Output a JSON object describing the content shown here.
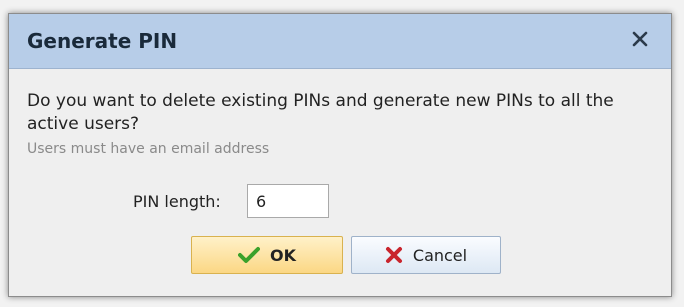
{
  "dialog": {
    "title": "Generate PIN",
    "message": "Do you want to delete existing PINs and generate new PINs to all the active users?",
    "hint": "Users must have an email address",
    "pin_length_label": "PIN length:",
    "pin_length_value": "6",
    "ok_label": "OK",
    "cancel_label": "Cancel",
    "close_icon": "close-icon",
    "ok_icon": "checkmark-icon",
    "cancel_icon": "red-x-icon"
  },
  "colors": {
    "titlebar": "#b7cde8",
    "ok_button": "#fbd784",
    "cancel_button": "#dde8f4",
    "check": "#3aa12b",
    "cancel_x": "#c9252d"
  }
}
